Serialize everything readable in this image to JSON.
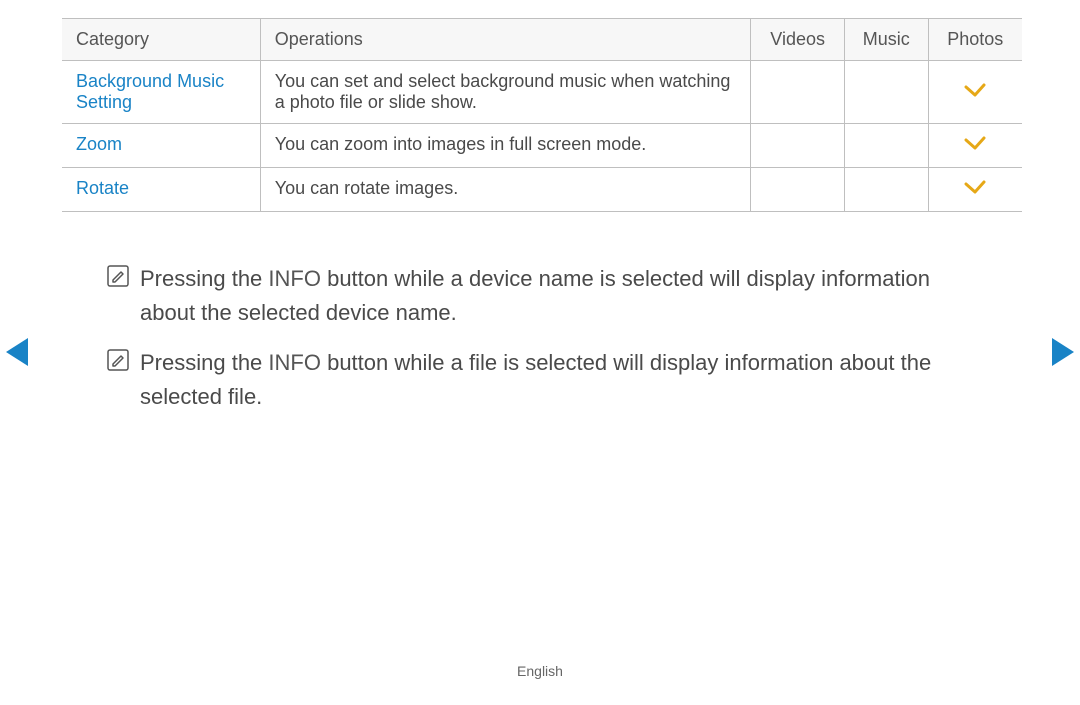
{
  "table": {
    "headers": {
      "category": "Category",
      "operations": "Operations",
      "videos": "Videos",
      "music": "Music",
      "photos": "Photos"
    },
    "rows": [
      {
        "category": "Background Music Setting",
        "operations": "You can set and select background music when watching a photo file or slide show.",
        "videos": false,
        "music": false,
        "photos": true
      },
      {
        "category": "Zoom",
        "operations": "You can zoom into images in full screen mode.",
        "videos": false,
        "music": false,
        "photos": true
      },
      {
        "category": "Rotate",
        "operations": "You can rotate images.",
        "videos": false,
        "music": false,
        "photos": true
      }
    ]
  },
  "notes": [
    {
      "pre": "Pressing the ",
      "bold": "INFO",
      "post": " button while a device name is selected will display information about the selected device name."
    },
    {
      "pre": "Pressing the ",
      "bold": "INFO",
      "post": " button while a file is selected will display information about the selected file."
    }
  ],
  "footer": {
    "language": "English"
  },
  "icons": {
    "check_glyph": "check",
    "note_glyph": "note-pencil",
    "nav_prev": "triangle-left",
    "nav_next": "triangle-right"
  },
  "colors": {
    "accent_blue": "#1983c6",
    "check_amber": "#e6a817",
    "rule_gray": "#bfbfbf"
  }
}
